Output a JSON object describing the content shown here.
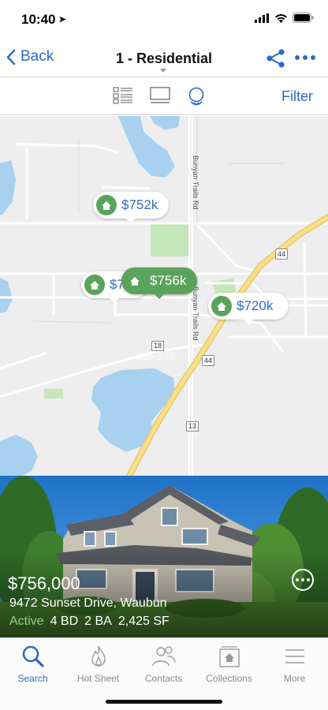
{
  "status_bar": {
    "time": "10:40",
    "location_icon": "location-arrow-icon"
  },
  "nav": {
    "back_label": "Back",
    "title": "1 - Residential"
  },
  "view_bar": {
    "filter_label": "Filter",
    "views": [
      "list-view-icon",
      "gallery-view-icon",
      "map-view-icon"
    ],
    "active_view": "map"
  },
  "map": {
    "road_labels": {
      "bunyan_1": "Bunyan Trails Rd",
      "bunyan_2": "Bunyan Trails Rd",
      "hwy_44a": "44",
      "hwy_44b": "44",
      "hwy_18": "18",
      "hwy_13": "13",
      "faded": "dee 538"
    },
    "pins": [
      {
        "price": "$752k",
        "style": "white"
      },
      {
        "price": "$7",
        "style": "white"
      },
      {
        "price": "$756k",
        "style": "green"
      },
      {
        "price": "$720k",
        "style": "white"
      }
    ]
  },
  "listing": {
    "price": "$756,000",
    "address": "9472 Sunset Drive, Waubun",
    "status": "Active",
    "beds": "4 BD",
    "baths": "2 BA",
    "sqft": "2,425 SF"
  },
  "tabs": [
    {
      "label": "Search",
      "icon": "search-icon",
      "active": true
    },
    {
      "label": "Hot Sheet",
      "icon": "flame-icon",
      "active": false
    },
    {
      "label": "Contacts",
      "icon": "contacts-icon",
      "active": false
    },
    {
      "label": "Collections",
      "icon": "collections-icon",
      "active": false
    },
    {
      "label": "More",
      "icon": "menu-icon",
      "active": false
    }
  ],
  "colors": {
    "accent": "#2e6cc0",
    "pin_green": "#5aa35a",
    "status_active": "#8fd27a"
  }
}
